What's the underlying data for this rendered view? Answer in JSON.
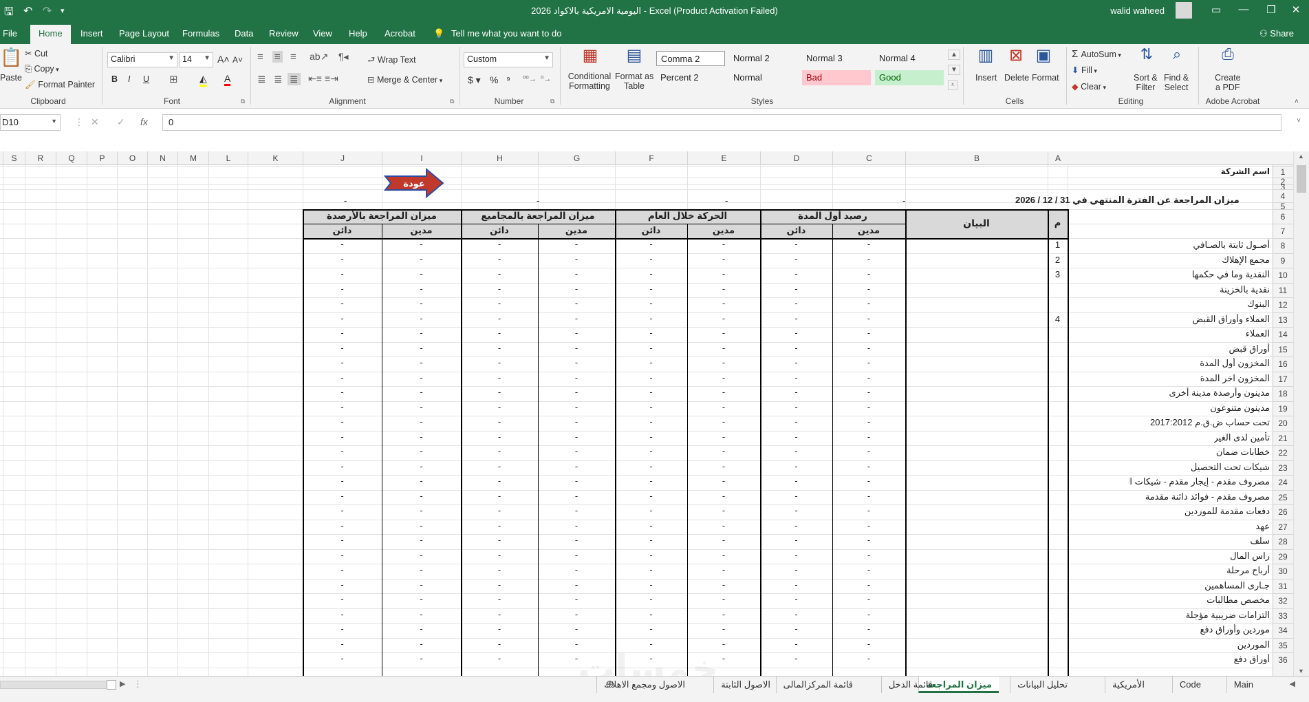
{
  "titlebar": {
    "title": "اليومية الامريكية بالاكواد 2026  -  Excel (Product Activation Failed)",
    "user": "walid waheed",
    "save_icon": "save-icon",
    "undo_icon": "undo-icon",
    "redo_icon": "redo-icon",
    "color": "#217346"
  },
  "tabs": [
    "File",
    "Home",
    "Insert",
    "Page Layout",
    "Formulas",
    "Data",
    "Review",
    "View",
    "Help",
    "Acrobat"
  ],
  "tell_me": "Tell me what you want to do",
  "share": "Share",
  "ribbon": {
    "paste": "Paste",
    "cut": "Cut",
    "copy": "Copy",
    "format_painter": "Format Painter",
    "clipboard": "Clipboard",
    "font_name": "Calibri",
    "font_size": "14",
    "font": "Font",
    "bold": "B",
    "italic": "I",
    "underline": "U",
    "wrap_text": "Wrap Text",
    "merge_center": "Merge & Center",
    "alignment": "Alignment",
    "number_format": "Custom",
    "number": "Number",
    "conditional_formatting": [
      "Conditional",
      "Formatting"
    ],
    "format_as_table": [
      "Format as",
      "Table"
    ],
    "styles": "Styles",
    "style_cells": [
      {
        "label": "Comma 2",
        "bg": "#ffffff"
      },
      {
        "label": "Normal 2",
        "bg": "#f3f3f3"
      },
      {
        "label": "Normal 3",
        "bg": "#f3f3f3"
      },
      {
        "label": "Normal 4",
        "bg": "#f3f3f3"
      },
      {
        "label": "Percent 2",
        "bg": "#f3f3f3"
      },
      {
        "label": "Normal",
        "bg": "#f3f3f3"
      },
      {
        "label": "Bad",
        "bg": "#ffc7ce"
      },
      {
        "label": "Good",
        "bg": "#c6efce"
      }
    ],
    "insert": "Insert",
    "delete": "Delete",
    "format": "Format",
    "cells": "Cells",
    "autosum": "AutoSum",
    "fill": "Fill",
    "clear": "Clear",
    "sort_filter": [
      "Sort &",
      "Filter"
    ],
    "find_select": [
      "Find &",
      "Select"
    ],
    "editing": "Editing",
    "create_pdf": [
      "Create",
      "a PDF"
    ],
    "adobe_acrobat": "Adobe Acrobat"
  },
  "formula_bar": {
    "name_box": "D10",
    "value": "0"
  },
  "columns": [
    "S",
    "R",
    "Q",
    "P",
    "O",
    "N",
    "M",
    "L",
    "K",
    "J",
    "I",
    "H",
    "G",
    "F",
    "E",
    "D",
    "C",
    "B",
    "A"
  ],
  "sheet": {
    "company": "اسم الشركة",
    "back_button": "عودة",
    "report_title": "ميزان المراجعة عن الفترة المنتهي في 31 / 12 / 2026",
    "col_statement": "البيان",
    "col_no": "م",
    "groups": [
      "رصيد أول المدة",
      "الحركة خلال العام",
      "ميزان المراجعة بالمجاميع",
      "ميزان المراجعة بالأرصدة"
    ],
    "debit": "مدين",
    "credit": "دائن",
    "dash": "-",
    "rows": [
      {
        "r": "8",
        "no": "1",
        "label": "أصـول ثابتة بالصـافي"
      },
      {
        "r": "9",
        "no": "2",
        "label": "مجمع الإهلاك"
      },
      {
        "r": "10",
        "no": "3",
        "label": "النقدية وما في حكمها"
      },
      {
        "r": "11",
        "no": "",
        "label": "نقدية بالخزينة"
      },
      {
        "r": "12",
        "no": "",
        "label": "البنوك"
      },
      {
        "r": "13",
        "no": "4",
        "label": "العملاء وأوراق القبض"
      },
      {
        "r": "14",
        "no": "",
        "label": "العملاء"
      },
      {
        "r": "15",
        "no": "",
        "label": "أوراق قبض"
      },
      {
        "r": "16",
        "no": "",
        "label": "المخزون أول المدة"
      },
      {
        "r": "17",
        "no": "",
        "label": "المخزون اخر المدة"
      },
      {
        "r": "18",
        "no": "",
        "label": "مدينون وأرصدة مدينة أخرى"
      },
      {
        "r": "19",
        "no": "",
        "label": "مدينون متنوعون"
      },
      {
        "r": "20",
        "no": "",
        "label": "تحت حساب ض.ق.م 2017:2012"
      },
      {
        "r": "21",
        "no": "",
        "label": "تأمين لدى الغير"
      },
      {
        "r": "22",
        "no": "",
        "label": "خطابات ضمان"
      },
      {
        "r": "23",
        "no": "",
        "label": "شيكات تحت التحصيل"
      },
      {
        "r": "24",
        "no": "",
        "label": "مصروف مقدم - إيجار مقدم - شيكات القيمة المضـ"
      },
      {
        "r": "25",
        "no": "",
        "label": "مصروف مقدم - فوائد دائنة مقدمة"
      },
      {
        "r": "26",
        "no": "",
        "label": "دفعات مقدمة للموردين"
      },
      {
        "r": "27",
        "no": "",
        "label": "عهد"
      },
      {
        "r": "28",
        "no": "",
        "label": "سلف"
      },
      {
        "r": "29",
        "no": "",
        "label": "راس المال"
      },
      {
        "r": "30",
        "no": "",
        "label": "أرباح مرحلة"
      },
      {
        "r": "31",
        "no": "",
        "label": "جـارى المساهمين"
      },
      {
        "r": "32",
        "no": "",
        "label": "مخصص مطالبات"
      },
      {
        "r": "33",
        "no": "",
        "label": "التزامات ضريبية مؤجلة"
      },
      {
        "r": "34",
        "no": "",
        "label": "موردين وأوراق دفع"
      },
      {
        "r": "35",
        "no": "",
        "label": "الموردين"
      },
      {
        "r": "36",
        "no": "",
        "label": "أوراق دفع"
      }
    ]
  },
  "sheet_tabs": [
    "Main",
    "Code",
    "الأمريكية",
    "تحليل البيانات",
    "ميزان المراجعة",
    "قائمة الدخل",
    "قائمة المركزالمالى",
    "الاصول الثابتة",
    "الاصول ومجمع الاهلاك"
  ],
  "active_sheet": "ميزان المراجعة"
}
